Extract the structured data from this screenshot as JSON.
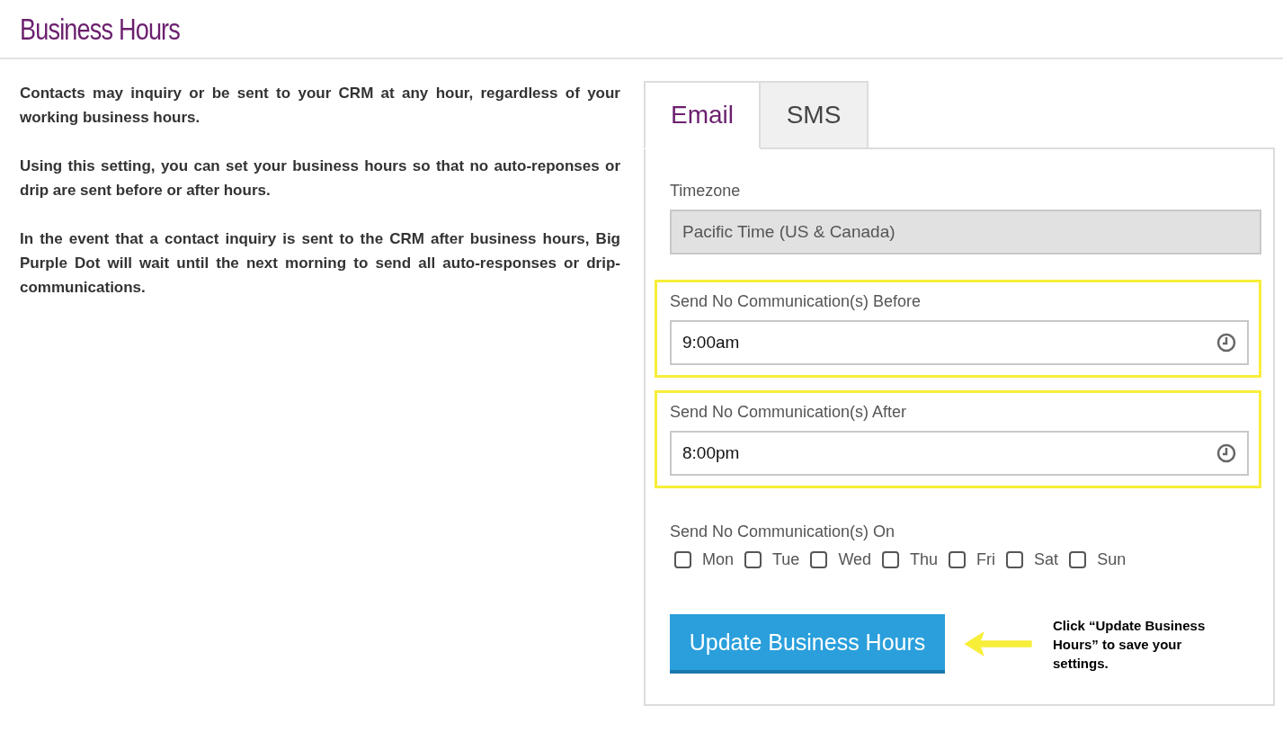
{
  "page_title": "Business Hours",
  "intro": [
    "Contacts may inquiry or be sent to your CRM at any hour, regardless of your working business hours.",
    "Using this setting, you can set your business hours so that no auto-reponses or drip are sent before or after hours.",
    "In the event that a contact inquiry is sent to the CRM after business hours, Big Purple Dot will wait until the next morning to send all auto-responses or drip-communications."
  ],
  "tabs": [
    {
      "label": "Email",
      "selected": true
    },
    {
      "label": "SMS",
      "selected": false
    }
  ],
  "timezone": {
    "label": "Timezone",
    "value": "Pacific Time (US & Canada)",
    "disabled": true
  },
  "time_fields": [
    {
      "label": "Send No Communication(s) Before",
      "value": "9:00am",
      "highlighted": true
    },
    {
      "label": "Send No Communication(s) After",
      "value": "8:00pm",
      "highlighted": true
    }
  ],
  "days": {
    "label": "Send No Communication(s) On",
    "items": [
      {
        "label": "Mon",
        "checked": false
      },
      {
        "label": "Tue",
        "checked": false
      },
      {
        "label": "Wed",
        "checked": false
      },
      {
        "label": "Thu",
        "checked": false
      },
      {
        "label": "Fri",
        "checked": false
      },
      {
        "label": "Sat",
        "checked": false
      },
      {
        "label": "Sun",
        "checked": false
      }
    ]
  },
  "submit_button": "Update Business Hours",
  "annotation": "Click “Update Business Hours” to save your settings."
}
